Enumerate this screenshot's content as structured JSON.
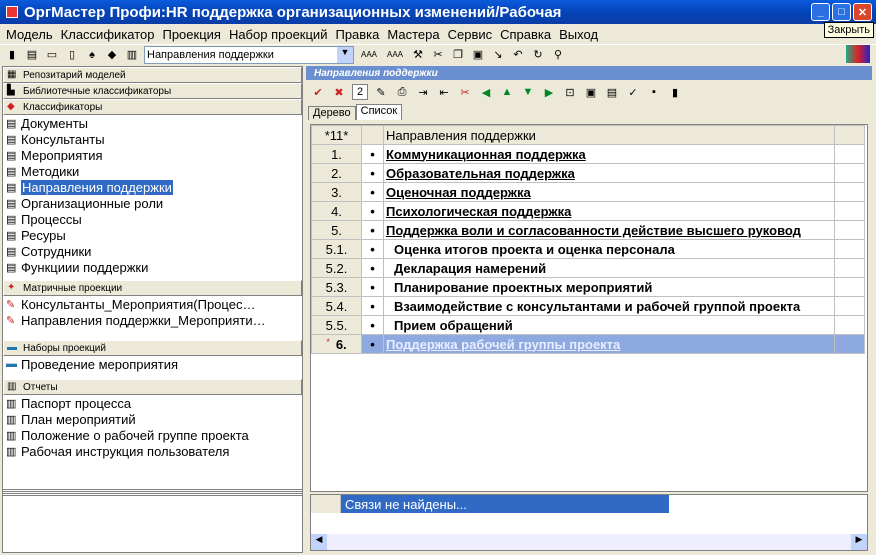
{
  "window": {
    "title": "ОргМастер Профи:HR поддержка организационных изменений/Рабочая",
    "tooltip": "Закрыть"
  },
  "menu": [
    "Модель",
    "Классификатор",
    "Проекция",
    "Набор проекций",
    "Правка",
    "Мастера",
    "Сервис",
    "Справка",
    "Выход"
  ],
  "toolbar": {
    "combo_value": "Направления поддержки",
    "font_a": "AAA",
    "font_b": "AAA"
  },
  "left": {
    "sections": {
      "repo": "Репозитарий моделей",
      "library": "Библиотечные классификаторы",
      "classifiers": "Классификаторы",
      "matrix": "Матричные проекции",
      "sets": "Наборы проекций",
      "reports": "Отчеты"
    },
    "classifier_items": [
      "Документы",
      "Консультанты",
      "Мероприятия",
      "Методики",
      "Направления поддержки",
      "Организационные роли",
      "Процессы",
      "Ресуры",
      "Сотрудники",
      "Функциии поддержки"
    ],
    "matrix_items": [
      "Консультанты_Мероприятия(Процес…",
      "Направления поддержки_Мероприяти…"
    ],
    "set_items": [
      "Проведение мероприятия"
    ],
    "report_items": [
      "Паспорт процесса",
      "План мероприятий",
      "Положение о рабочей группе проекта",
      "Рабочая инструкция пользователя"
    ]
  },
  "right": {
    "title": "Направления поддержки",
    "zoom": "2",
    "tabs": [
      "Дерево",
      "Список"
    ],
    "grid_header": {
      "num": "*11*",
      "col": "Направления поддержки"
    },
    "rows": [
      {
        "num": "1.",
        "text": "Коммуникационная поддержка"
      },
      {
        "num": "2.",
        "text": "Образовательная поддержка"
      },
      {
        "num": "3.",
        "text": "Оценочная поддержка"
      },
      {
        "num": "4.",
        "text": "Психологическая поддержка"
      },
      {
        "num": "5.",
        "text": "Поддержка воли и согласованности действие высшего руковод"
      },
      {
        "num": "5.1.",
        "text": "Оценка итогов проекта и оценка персонала"
      },
      {
        "num": "5.2.",
        "text": "Декларация намерений"
      },
      {
        "num": "5.3.",
        "text": "Планирование проектных мероприятий"
      },
      {
        "num": "5.4.",
        "text": "Взаимодействие с консультантами и рабочей группой проекта"
      },
      {
        "num": "5.5.",
        "text": "Прием обращений"
      },
      {
        "num": "6.",
        "text": "Поддержка рабочей группы проекта"
      }
    ],
    "new_marker": "*",
    "bullet": "•",
    "status": "Связи не найдены..."
  }
}
